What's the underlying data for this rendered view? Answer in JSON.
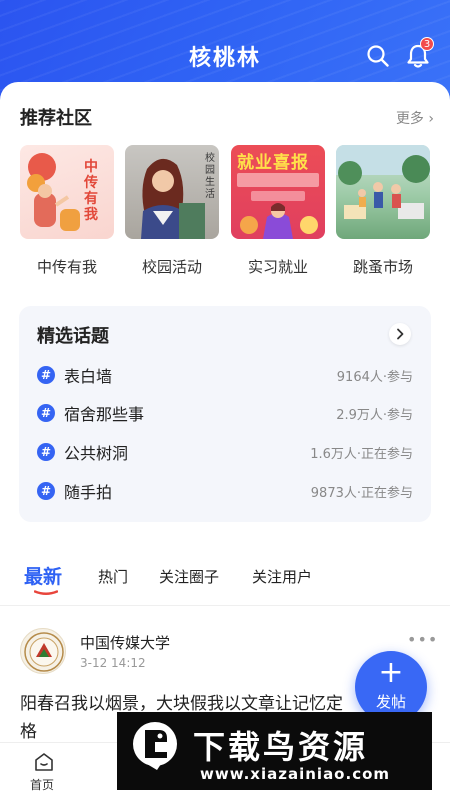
{
  "header": {
    "title": "核桃林",
    "notification_count": "3",
    "color": "#2f62f4"
  },
  "communities": {
    "title": "推荐社区",
    "more": "更多",
    "items": [
      {
        "label": "中传有我",
        "thumb_text": "中传有我"
      },
      {
        "label": "校园活动",
        "thumb_text": "校园生活"
      },
      {
        "label": "实习就业",
        "thumb_text": "就业喜报"
      },
      {
        "label": "跳蚤市场",
        "thumb_text": ""
      }
    ]
  },
  "topics": {
    "title": "精选话题",
    "items": [
      {
        "name": "表白墙",
        "meta": "9164人·参与"
      },
      {
        "name": "宿舍那些事",
        "meta": "2.9万人·参与"
      },
      {
        "name": "公共树洞",
        "meta": "1.6万人·正在参与"
      },
      {
        "name": "随手拍",
        "meta": "9873人·正在参与"
      }
    ]
  },
  "feed_tabs": [
    "最新",
    "热门",
    "关注圈子",
    "关注用户"
  ],
  "post": {
    "author": "中国传媒大学",
    "time": "3-12 14:12",
    "text": "阳春召我以烟景，大块假我以文章让记忆定格"
  },
  "fab": {
    "label": "发帖"
  },
  "bottom_nav": {
    "home": "首页"
  },
  "watermark": {
    "main": "下载鸟资源",
    "url": "www.xiazainiao.com"
  }
}
